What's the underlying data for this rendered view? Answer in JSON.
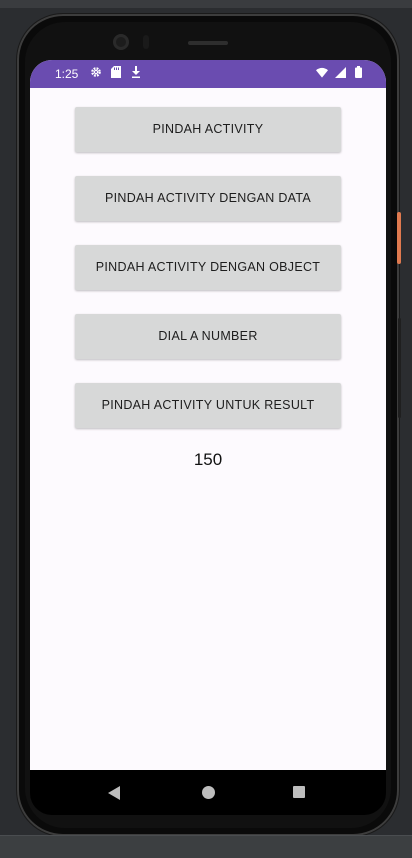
{
  "status_bar": {
    "time": "1:25",
    "left_icons": [
      "settings-icon",
      "sd-card-icon",
      "download-icon"
    ],
    "right_icons": [
      "wifi-icon",
      "signal-icon",
      "battery-icon"
    ],
    "color": "#6a4cb0"
  },
  "buttons": [
    {
      "label": "PINDAH ACTIVITY"
    },
    {
      "label": "PINDAH ACTIVITY DENGAN DATA"
    },
    {
      "label": "PINDAH ACTIVITY DENGAN OBJECT"
    },
    {
      "label": "DIAL A NUMBER"
    },
    {
      "label": "PINDAH ACTIVITY UNTUK RESULT"
    }
  ],
  "result_text": "150",
  "nav_bar": {
    "buttons": [
      "back-icon",
      "home-icon",
      "recents-icon"
    ]
  }
}
